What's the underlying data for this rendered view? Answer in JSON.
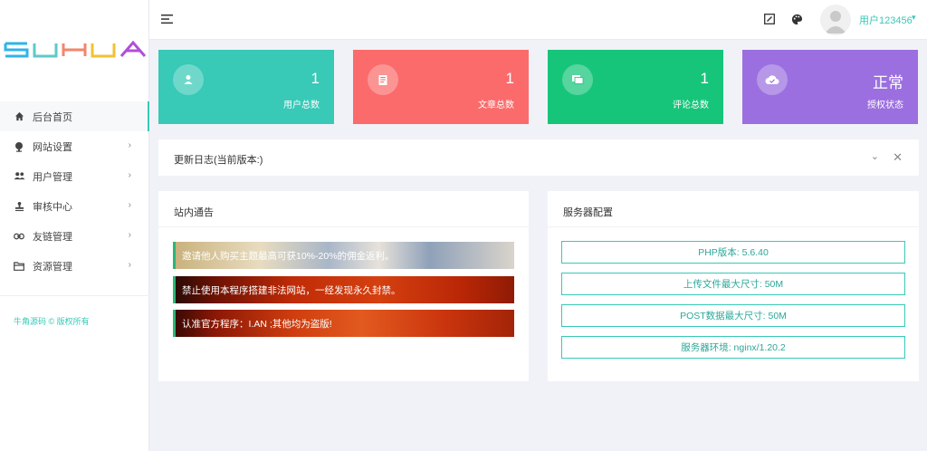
{
  "sidebar": {
    "logo_text": "SUHUA",
    "items": [
      {
        "label": "后台首页",
        "icon": "home-icon"
      },
      {
        "label": "网站设置",
        "icon": "globe-icon"
      },
      {
        "label": "用户管理",
        "icon": "users-icon"
      },
      {
        "label": "审核中心",
        "icon": "stamp-icon"
      },
      {
        "label": "友链管理",
        "icon": "link-icon"
      },
      {
        "label": "资源管理",
        "icon": "folder-icon"
      }
    ],
    "chevron": "›",
    "footer": "牛角源码 © 版权所有"
  },
  "header": {
    "username": "用户123456",
    "caret": "▾"
  },
  "stats": [
    {
      "value": "1",
      "label": "用户总数",
      "color": "#38c9b7",
      "icon": "user-icon"
    },
    {
      "value": "1",
      "label": "文章总数",
      "color": "#fb6b6b",
      "icon": "document-icon"
    },
    {
      "value": "1",
      "label": "评论总数",
      "color": "#16c57a",
      "icon": "comment-icon"
    },
    {
      "value": "正常",
      "label": "授权状态",
      "color": "#9c6fe0",
      "icon": "cloud-check-icon"
    }
  ],
  "update_log": {
    "title": "更新日志(当前版本:)",
    "collapse": "⌄",
    "close": "✕"
  },
  "notice": {
    "title": "站内通告",
    "items": [
      "邀请他人购买主题最高可获10%-20%的佣金返利。",
      "禁止使用本程序搭建非法网站，一经发现永久封禁。",
      "认准官方程序：I.AN ;其他均为盗版!"
    ]
  },
  "server": {
    "title": "服务器配置",
    "items": [
      "PHP版本: 5.6.40",
      "上传文件最大尺寸: 50M",
      "POST数据最大尺寸: 50M",
      "服务器环境: nginx/1.20.2"
    ]
  }
}
